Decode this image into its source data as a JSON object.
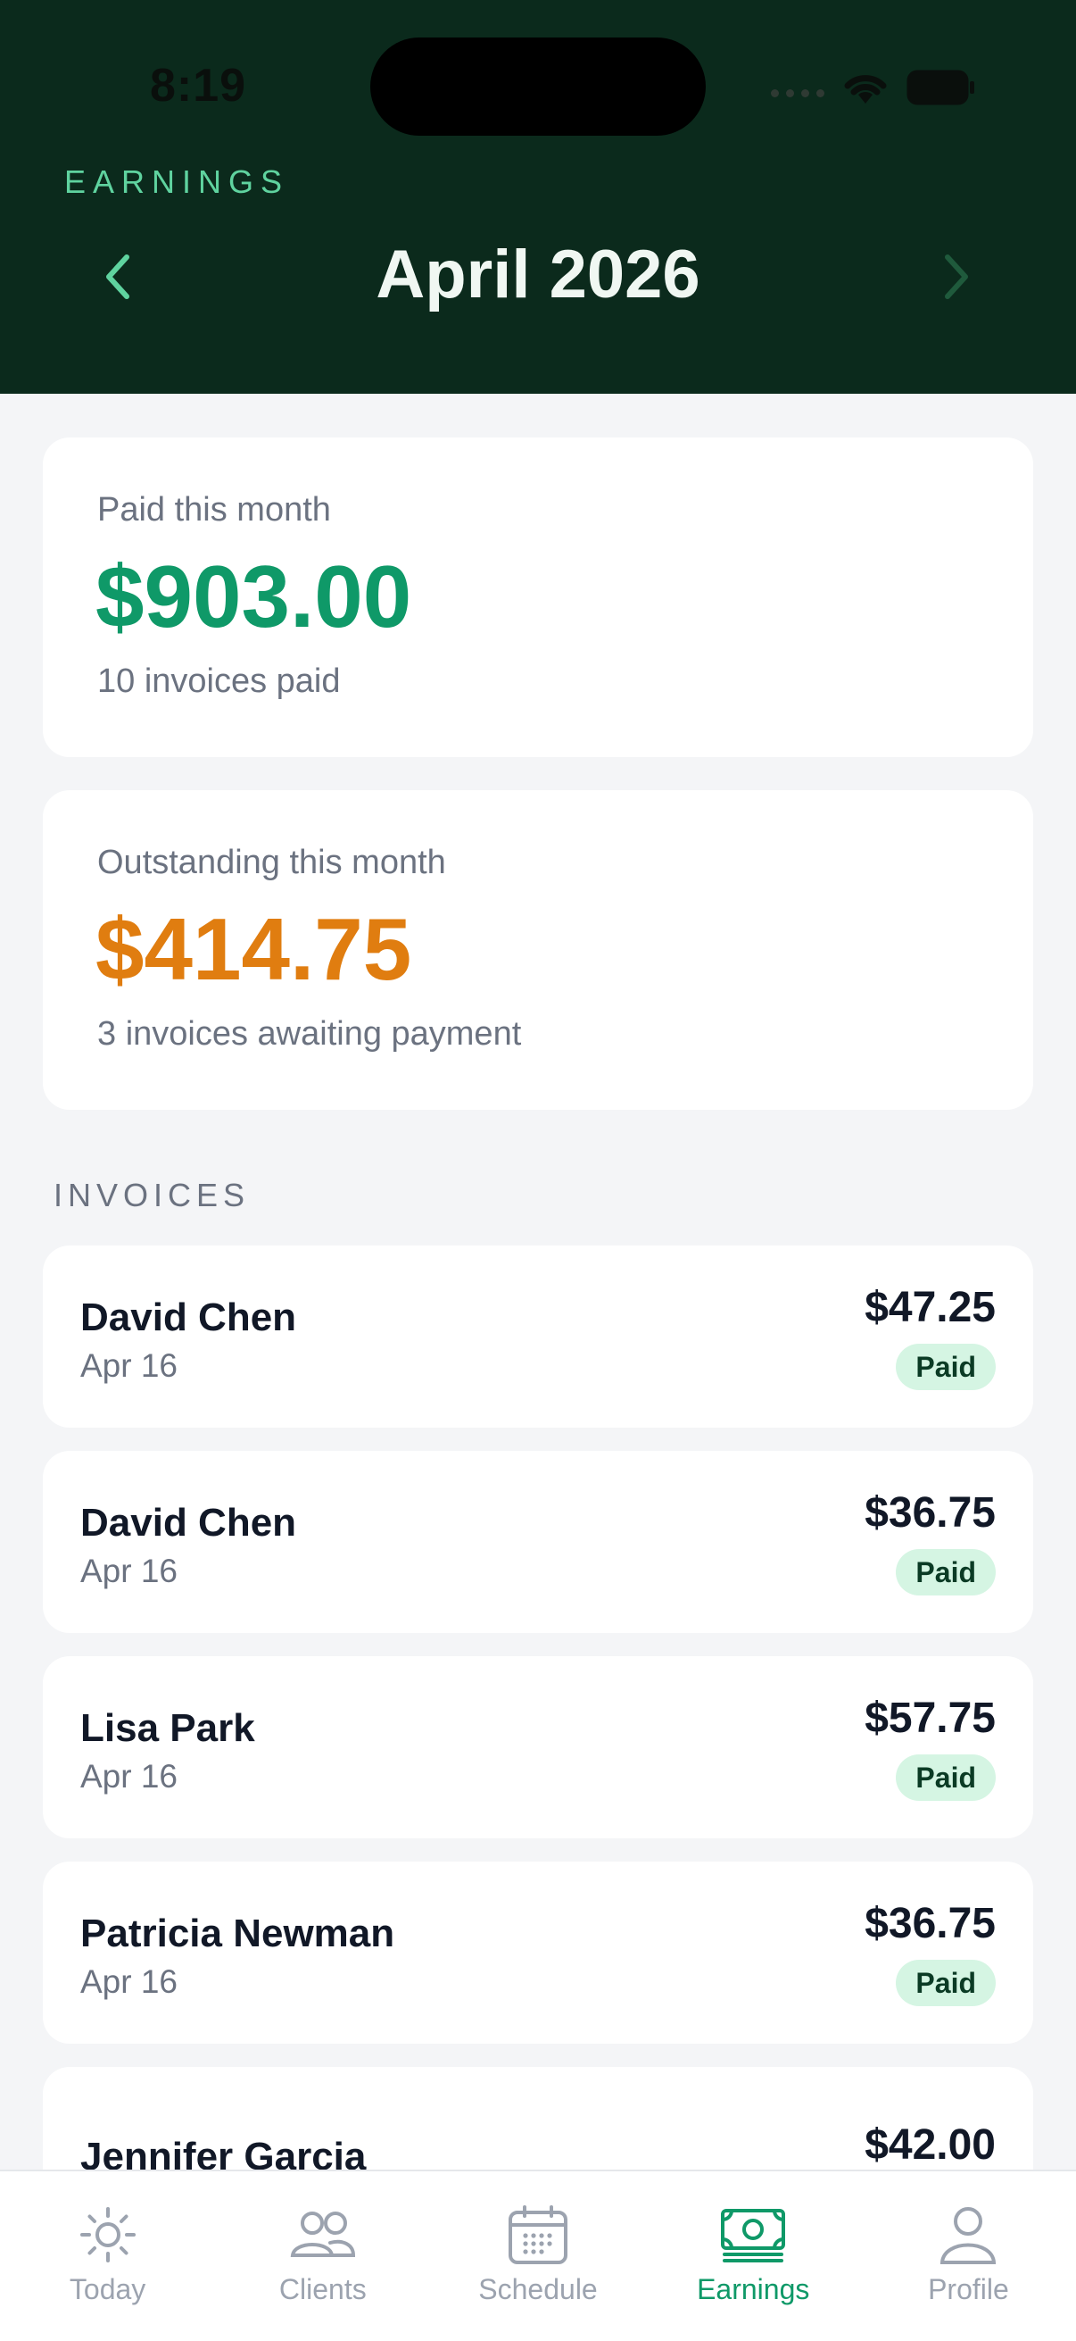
{
  "status_bar": {
    "time": "8:19"
  },
  "header": {
    "eyebrow": "EARNINGS",
    "month": "April 2026"
  },
  "summary": {
    "paid": {
      "label": "Paid this month",
      "amount": "$903.00",
      "sub": "10 invoices paid",
      "color": "#0f9968"
    },
    "outstanding": {
      "label": "Outstanding this month",
      "amount": "$414.75",
      "sub": "3 invoices awaiting payment",
      "color": "#e07d10"
    }
  },
  "invoices": {
    "section_label": "INVOICES",
    "items": [
      {
        "name": "David Chen",
        "date": "Apr 16",
        "amount": "$47.25",
        "status": "Paid"
      },
      {
        "name": "David Chen",
        "date": "Apr 16",
        "amount": "$36.75",
        "status": "Paid"
      },
      {
        "name": "Lisa Park",
        "date": "Apr 16",
        "amount": "$57.75",
        "status": "Paid"
      },
      {
        "name": "Patricia Newman",
        "date": "Apr 16",
        "amount": "$36.75",
        "status": "Paid"
      },
      {
        "name": "Jennifer Garcia",
        "date": "",
        "amount": "$42.00",
        "status": ""
      }
    ]
  },
  "tabbar": {
    "tabs": [
      {
        "label": "Today",
        "icon": "sun-icon",
        "active": false
      },
      {
        "label": "Clients",
        "icon": "users-icon",
        "active": false
      },
      {
        "label": "Schedule",
        "icon": "calendar-icon",
        "active": false
      },
      {
        "label": "Earnings",
        "icon": "cash-icon",
        "active": true
      },
      {
        "label": "Profile",
        "icon": "person-icon",
        "active": false
      }
    ],
    "accent": "#0f9968",
    "inactive": "#9ca3af"
  }
}
